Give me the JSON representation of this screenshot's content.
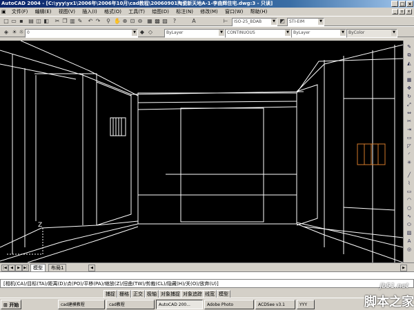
{
  "app": {
    "title": "AutoCAD 2004 - [C:\\yyy\\yx1\\2006年\\2006年10月\\cad教程\\20060901陶瓷新天地A-1-李曲辉住宅.dwg:3 - 只读]",
    "window_controls": [
      "_",
      "□",
      "×"
    ]
  },
  "menu": {
    "items": [
      "文件(F)",
      "编辑(E)",
      "视图(V)",
      "插入(I)",
      "格式(O)",
      "工具(T)",
      "绘图(D)",
      "标注(N)",
      "修改(M)",
      "窗口(W)",
      "帮助(H)"
    ]
  },
  "toolbar1": {
    "style_combo": "ISO-25_BDAB",
    "font_combo": "STI-EIM"
  },
  "toolbar2": {
    "layer_combo": "0",
    "color_combo": "ByLayer",
    "linetype_combo": "CONTINUOUS",
    "lineweight_combo": "ByLayer",
    "plotstyle_combo": "ByColor"
  },
  "layout_tabs": [
    "模型",
    "布局1"
  ],
  "axis_label": "Z",
  "command_line": "[相机(CA)/目标(TA)/距离(D)/点(PO)/平移(PA)/缩放(Z)/扭曲(TW)/剪裁(CL)/隐藏(H)/关(O)/放弃(U)]",
  "status_buttons": [
    "捕捉",
    "栅格",
    "正交",
    "极轴",
    "对象捕捉",
    "对象追踪",
    "线宽",
    "模型"
  ],
  "taskbar": {
    "start": "开始",
    "tasks": [
      "cad建模教程",
      "cad教程",
      "AutoCAD 200...",
      "Adobe Photo",
      "ACDSee v3.1",
      "YYY"
    ]
  },
  "watermark": {
    "url": "jb51.net",
    "text": "脚本之家"
  },
  "colors": {
    "title_active": "#0a246a",
    "canvas_bg": "#000000",
    "wireframe": "#ffffff",
    "highlight_object": "#d47a2a"
  }
}
